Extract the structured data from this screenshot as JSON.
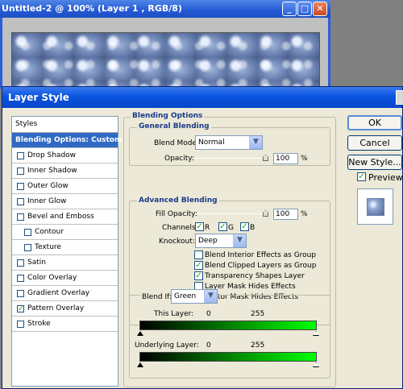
{
  "doc_window": {
    "title": "Untitled-2 @ 100% (Layer 1 , RGB/8)",
    "buttons": {
      "minimize": "_",
      "maximize": "□",
      "close": "✕"
    }
  },
  "dialog": {
    "title": "Layer Style",
    "styles_header": "Styles",
    "styles": [
      {
        "label": "Blending Options: Custom",
        "selected": true
      },
      {
        "label": "Drop Shadow",
        "checked": false
      },
      {
        "label": "Inner Shadow",
        "checked": false
      },
      {
        "label": "Outer Glow",
        "checked": false
      },
      {
        "label": "Inner Glow",
        "checked": false
      },
      {
        "label": "Bevel and Emboss",
        "checked": false
      },
      {
        "label": "Contour",
        "checked": false,
        "indent": true
      },
      {
        "label": "Texture",
        "checked": false,
        "indent": true
      },
      {
        "label": "Satin",
        "checked": false
      },
      {
        "label": "Color Overlay",
        "checked": false
      },
      {
        "label": "Gradient Overlay",
        "checked": false
      },
      {
        "label": "Pattern Overlay",
        "checked": true
      },
      {
        "label": "Stroke",
        "checked": false
      }
    ],
    "blending_options": {
      "title": "Blending Options",
      "general": {
        "title": "General Blending",
        "blend_mode_label": "Blend Mode:",
        "blend_mode": "Normal",
        "opacity_label": "Opacity:",
        "opacity": "100",
        "percent": "%"
      },
      "advanced": {
        "title": "Advanced Blending",
        "fill_opacity_label": "Fill Opacity:",
        "fill_opacity": "100",
        "percent": "%",
        "channels_label": "Channels:",
        "channels": [
          "R",
          "G",
          "B"
        ],
        "knockout_label": "Knockout:",
        "knockout": "Deep",
        "options": [
          {
            "label": "Blend Interior Effects as Group",
            "checked": false
          },
          {
            "label": "Blend Clipped Layers as Group",
            "checked": true
          },
          {
            "label": "Transparency Shapes Layer",
            "checked": true
          },
          {
            "label": "Layer Mask Hides Effects",
            "checked": false
          },
          {
            "label": "Vector Mask Hides Effects",
            "checked": false
          }
        ]
      },
      "blend_if": {
        "label": "Blend If:",
        "value": "Green",
        "this_layer_label": "This Layer:",
        "this_layer_min": "0",
        "this_layer_max": "255",
        "underlying_label": "Underlying Layer:",
        "underlying_min": "0",
        "underlying_max": "255",
        "color": "#00ff00"
      }
    },
    "buttons": {
      "ok": "OK",
      "cancel": "Cancel",
      "new_style": "New Style...",
      "preview_label": "Preview"
    }
  }
}
